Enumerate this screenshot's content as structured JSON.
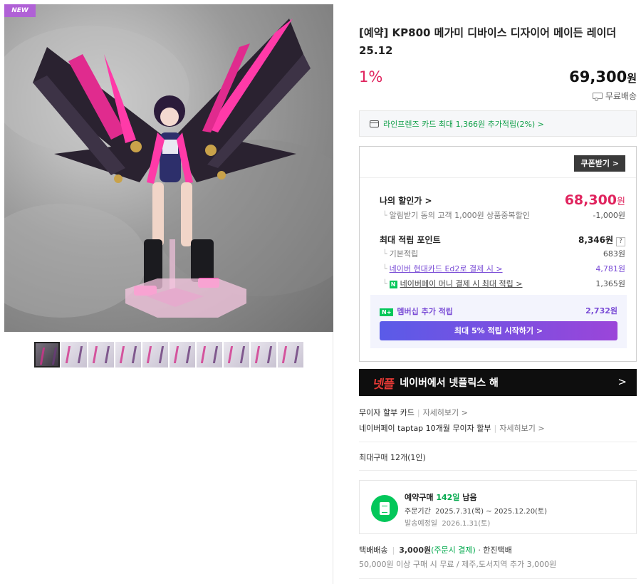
{
  "gallery": {
    "badge": "NEW",
    "thumbnail_count": 10,
    "selected_thumbnail": 1
  },
  "product": {
    "title": "[예약] KP800 메가미 디바이스 디자이어 메이든 레이더 25.12",
    "discount_rate": "1%",
    "price": "69,300",
    "price_unit": "원",
    "shipping_label": "무료배송"
  },
  "card_benefit": {
    "text": "라인프렌즈 카드 최대 1,366원 추가적립(2%) >"
  },
  "benefits": {
    "coupon_button": "쿠폰받기 >",
    "my_price_label": "나의 할인가 >",
    "my_price": "68,300",
    "my_price_unit": "원",
    "alarm_discount_label": "알림받기 동의 고객 1,000원 상품중복할인",
    "alarm_discount_value": "-1,000원",
    "max_points_label": "최대 적립 포인트",
    "max_points_value": "8,346원",
    "help": "?",
    "base_points_label": "기본적립",
    "base_points_value": "683원",
    "hyundai_card_label": "네이버 현대카드 Ed2로 결제 시 >",
    "hyundai_card_value": "4,781원",
    "npay_money_label": "네이버페이 머니 결제 시 최대 적립 >",
    "npay_money_value": "1,365원",
    "npay_icon": "N",
    "membership_badge": "N+",
    "membership_label": "멤버십 추가 적립",
    "membership_value": "2,732원",
    "start_button": "최대 5% 적립 시작하기 >"
  },
  "netflix_banner": {
    "logo": "넷",
    "logo_accent": "플",
    "text": "네이버에서 넷플릭스 해",
    "arrow": ">"
  },
  "installments": [
    {
      "label": "무이자 할부 카드",
      "more": "자세히보기 >"
    },
    {
      "label": "네이버페이 taptap 10개월 무이자 할부",
      "more": "자세히보기 >"
    }
  ],
  "max_purchase": "최대구매 12개(1인)",
  "reservation": {
    "title_prefix": "예약구매",
    "days": "142일",
    "title_suffix": "남음",
    "order_period_label": "주문기간",
    "order_period": "2025.7.31(목) ~ 2025.12.20(토)",
    "ship_date_label": "발송예정일",
    "ship_date": "2026.1.31(토)"
  },
  "delivery": {
    "method": "택배배송",
    "fee": "3,000원",
    "fee_note": "(주문시 결제)",
    "carrier": "· 한진택배",
    "note": "50,000원 이상 구매 시 무료 / 제주,도서지역 추가 3,000원"
  },
  "colors": {
    "accent_red": "#e0245e",
    "naver_green": "#03c75a",
    "purple": "#7a4cd6"
  }
}
